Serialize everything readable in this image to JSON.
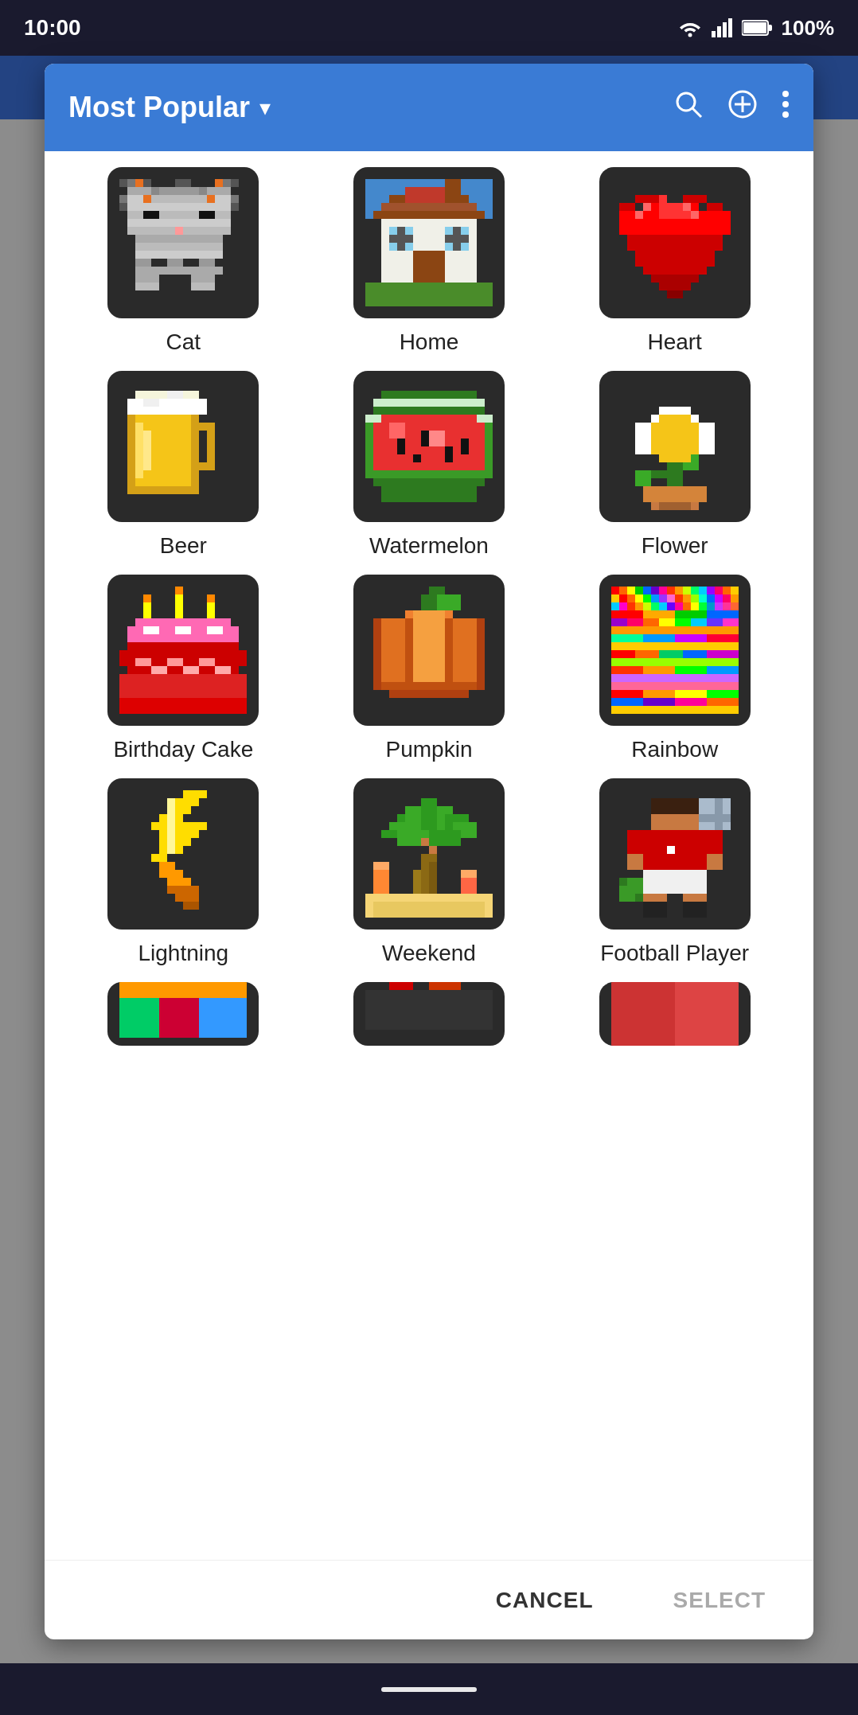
{
  "statusBar": {
    "time": "10:00",
    "battery": "100%"
  },
  "dialog": {
    "title": "Most Popular",
    "header": {
      "searchLabel": "search",
      "addLabel": "add",
      "moreLabel": "more"
    },
    "items": [
      {
        "id": "cat",
        "label": "Cat",
        "type": "cat"
      },
      {
        "id": "home",
        "label": "Home",
        "type": "home"
      },
      {
        "id": "heart",
        "label": "Heart",
        "type": "heart"
      },
      {
        "id": "beer",
        "label": "Beer",
        "type": "beer"
      },
      {
        "id": "watermelon",
        "label": "Watermelon",
        "type": "watermelon"
      },
      {
        "id": "flower",
        "label": "Flower",
        "type": "flower"
      },
      {
        "id": "birthday-cake",
        "label": "Birthday Cake",
        "type": "birthday-cake"
      },
      {
        "id": "pumpkin",
        "label": "Pumpkin",
        "type": "pumpkin"
      },
      {
        "id": "rainbow",
        "label": "Rainbow",
        "type": "rainbow"
      },
      {
        "id": "lightning",
        "label": "Lightning",
        "type": "lightning"
      },
      {
        "id": "weekend",
        "label": "Weekend",
        "type": "weekend"
      },
      {
        "id": "football-player",
        "label": "Football Player",
        "type": "football-player"
      },
      {
        "id": "partial1",
        "label": "",
        "type": "partial1"
      },
      {
        "id": "partial2",
        "label": "",
        "type": "partial2"
      },
      {
        "id": "partial3",
        "label": "",
        "type": "partial3"
      }
    ],
    "footer": {
      "cancelLabel": "CANCEL",
      "selectLabel": "SELECT"
    }
  }
}
